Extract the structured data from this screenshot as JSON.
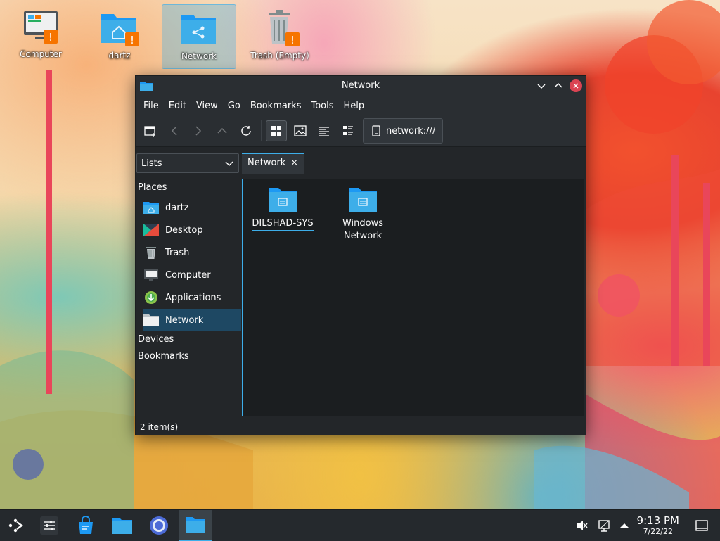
{
  "desktop": {
    "icons": [
      {
        "label": "Computer",
        "icon": "computer-icon",
        "warning": "!"
      },
      {
        "label": "dartz",
        "icon": "home-folder-icon",
        "warning": "!"
      },
      {
        "label": "Network",
        "icon": "network-folder-icon"
      },
      {
        "label": "Trash (Empty)",
        "icon": "trash-icon",
        "warning": "!"
      }
    ]
  },
  "window": {
    "title": "Network",
    "menu": [
      "File",
      "Edit",
      "View",
      "Go",
      "Bookmarks",
      "Tools",
      "Help"
    ],
    "location": "network:///",
    "panel_select": "Lists",
    "tab": {
      "label": "Network",
      "close": "×"
    },
    "sidebar": {
      "places_header": "Places",
      "places": [
        {
          "label": "dartz",
          "icon": "home-folder-icon"
        },
        {
          "label": "Desktop",
          "icon": "desktop-icon"
        },
        {
          "label": "Trash",
          "icon": "trash-icon"
        },
        {
          "label": "Computer",
          "icon": "computer-icon"
        },
        {
          "label": "Applications",
          "icon": "applications-icon"
        },
        {
          "label": "Network",
          "icon": "network-folder-icon",
          "active": true
        }
      ],
      "devices_header": "Devices",
      "bookmarks_header": "Bookmarks"
    },
    "files": [
      {
        "name": "DILSHAD-SYS",
        "icon": "network-share-folder-icon"
      },
      {
        "name_line1": "Windows",
        "name_line2": "Network",
        "icon": "network-share-folder-icon"
      }
    ],
    "status": "2 item(s)"
  },
  "taskbar": {
    "clock_time": "9:13 PM",
    "clock_date": "7/22/22"
  },
  "colors": {
    "accent": "#3daee9",
    "window_bg": "#232629",
    "view_bg": "#1b1e20",
    "folder_blue": "#3daee9",
    "warning_orange": "#f67400",
    "close_red": "#da4453"
  }
}
